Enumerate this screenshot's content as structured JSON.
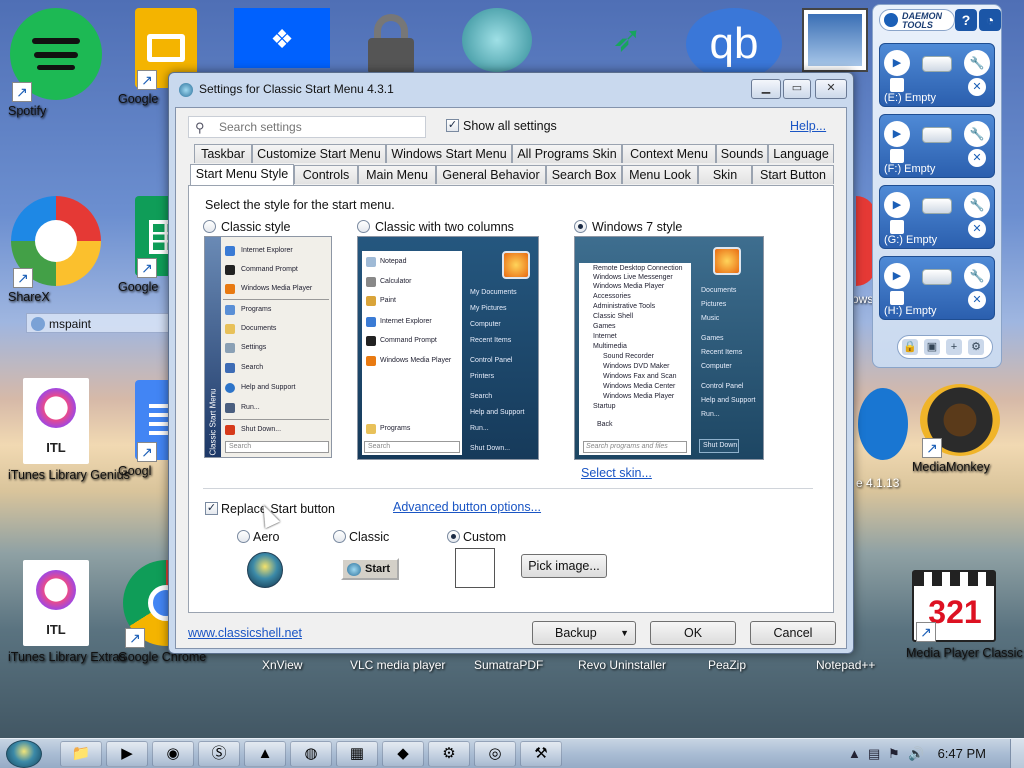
{
  "desktop": {
    "icons": [
      {
        "name": "Spotify",
        "label": "Spotify"
      },
      {
        "name": "Google Slides",
        "label": "Google"
      },
      {
        "name": "ShareX",
        "label": "ShareX"
      },
      {
        "name": "Google Sheets",
        "label": "Google"
      },
      {
        "name": "iTunes Library Genius",
        "label": "iTunes Library Genius"
      },
      {
        "name": "Google Docs",
        "label": "Googl"
      },
      {
        "name": "iTunes Library Extras",
        "label": "iTunes Library Extras"
      },
      {
        "name": "Google Chrome",
        "label": "Google Chrome"
      },
      {
        "name": "XnView",
        "label": "XnView"
      },
      {
        "name": "VLC media player",
        "label": "VLC media player"
      },
      {
        "name": "SumatraPDF",
        "label": "SumatraPDF"
      },
      {
        "name": "Revo Uninstaller",
        "label": "Revo Uninstaller"
      },
      {
        "name": "PeaZip",
        "label": "PeaZip"
      },
      {
        "name": "Notepad++",
        "label": "Notepad++"
      },
      {
        "name": "Media Player Classic",
        "label": "Media Player Classic"
      },
      {
        "name": "MediaMonkey",
        "label": "MediaMonkey"
      },
      {
        "name": "Edge",
        "label": "e 4.1.13"
      },
      {
        "name": "ows",
        "label": "ows"
      }
    ],
    "itl_text": "ITL",
    "drag_ghost_label": "mspaint"
  },
  "daemon": {
    "title_line1": "DAEMON",
    "title_line2": "TOOLS",
    "help_glyph": "?",
    "drives": [
      {
        "label": "(E:) Empty"
      },
      {
        "label": "(F:) Empty"
      },
      {
        "label": "(G:) Empty"
      },
      {
        "label": "(H:) Empty"
      }
    ]
  },
  "window": {
    "title": "Settings for Classic Start Menu 4.3.1",
    "search_placeholder": "Search settings",
    "show_all_label": "Show all settings",
    "help_link": "Help...",
    "tabs_row1": [
      "Taskbar",
      "Customize Start Menu",
      "Windows Start Menu",
      "All Programs Skin",
      "Context Menu",
      "Sounds",
      "Language"
    ],
    "tabs_row2": [
      "Start Menu Style",
      "Controls",
      "Main Menu",
      "General Behavior",
      "Search Box",
      "Menu Look",
      "Skin",
      "Start Button"
    ],
    "active_tab": "Start Menu Style",
    "select_style_text": "Select the style for the start menu.",
    "styles": [
      {
        "label": "Classic style",
        "selected": false
      },
      {
        "label": "Classic with two columns",
        "selected": false
      },
      {
        "label": "Windows 7 style",
        "selected": true
      }
    ],
    "classic_preview": {
      "items": [
        "Internet Explorer",
        "Command Prompt",
        "Windows Media Player",
        "Programs",
        "Documents",
        "Settings",
        "Search",
        "Help and Support",
        "Run...",
        "Shut Down..."
      ],
      "side_text": "Classic Start Menu",
      "search": "Search"
    },
    "two_col_preview": {
      "left": [
        "Notepad",
        "Calculator",
        "Paint",
        "Internet Explorer",
        "Command Prompt",
        "Windows Media Player",
        "Programs"
      ],
      "right": [
        "My Documents",
        "My Pictures",
        "Computer",
        "Recent Items",
        "Control Panel",
        "Printers",
        "Search",
        "Help and Support",
        "Run...",
        "Shut Down..."
      ],
      "search": "Search"
    },
    "win7_preview": {
      "left": [
        "Remote Desktop Connection",
        "Windows Live Messenger",
        "Windows Media Player",
        "Accessories",
        "Administrative Tools",
        "Classic Shell",
        "Games",
        "Internet",
        "Multimedia",
        "Sound Recorder",
        "Windows DVD Maker",
        "Windows Fax and Scan",
        "Windows Media Center",
        "Windows Media Player",
        "Startup",
        "Back"
      ],
      "right": [
        "Documents",
        "Pictures",
        "Music",
        "Games",
        "Recent Items",
        "Computer",
        "Control Panel",
        "Help and Support",
        "Run..."
      ],
      "search": "Search programs and files",
      "shutdown": "Shut Down"
    },
    "select_skin_link": "Select skin...",
    "replace_start_label": "Replace Start button",
    "advanced_link": "Advanced button options...",
    "button_styles": [
      {
        "label": "Aero",
        "selected": false
      },
      {
        "label": "Classic",
        "selected": false
      },
      {
        "label": "Custom",
        "selected": true
      }
    ],
    "classic_btn_text": "Start",
    "pick_image_label": "Pick image...",
    "footer_link": "www.classicshell.net",
    "backup_label": "Backup",
    "ok_label": "OK",
    "cancel_label": "Cancel"
  },
  "taskbar": {
    "clock": "6:47 PM",
    "pinned": [
      "explorer",
      "media",
      "chrome",
      "skype",
      "vlc",
      "firefox",
      "winrar",
      "app",
      "steam",
      "app2",
      "settings"
    ]
  }
}
